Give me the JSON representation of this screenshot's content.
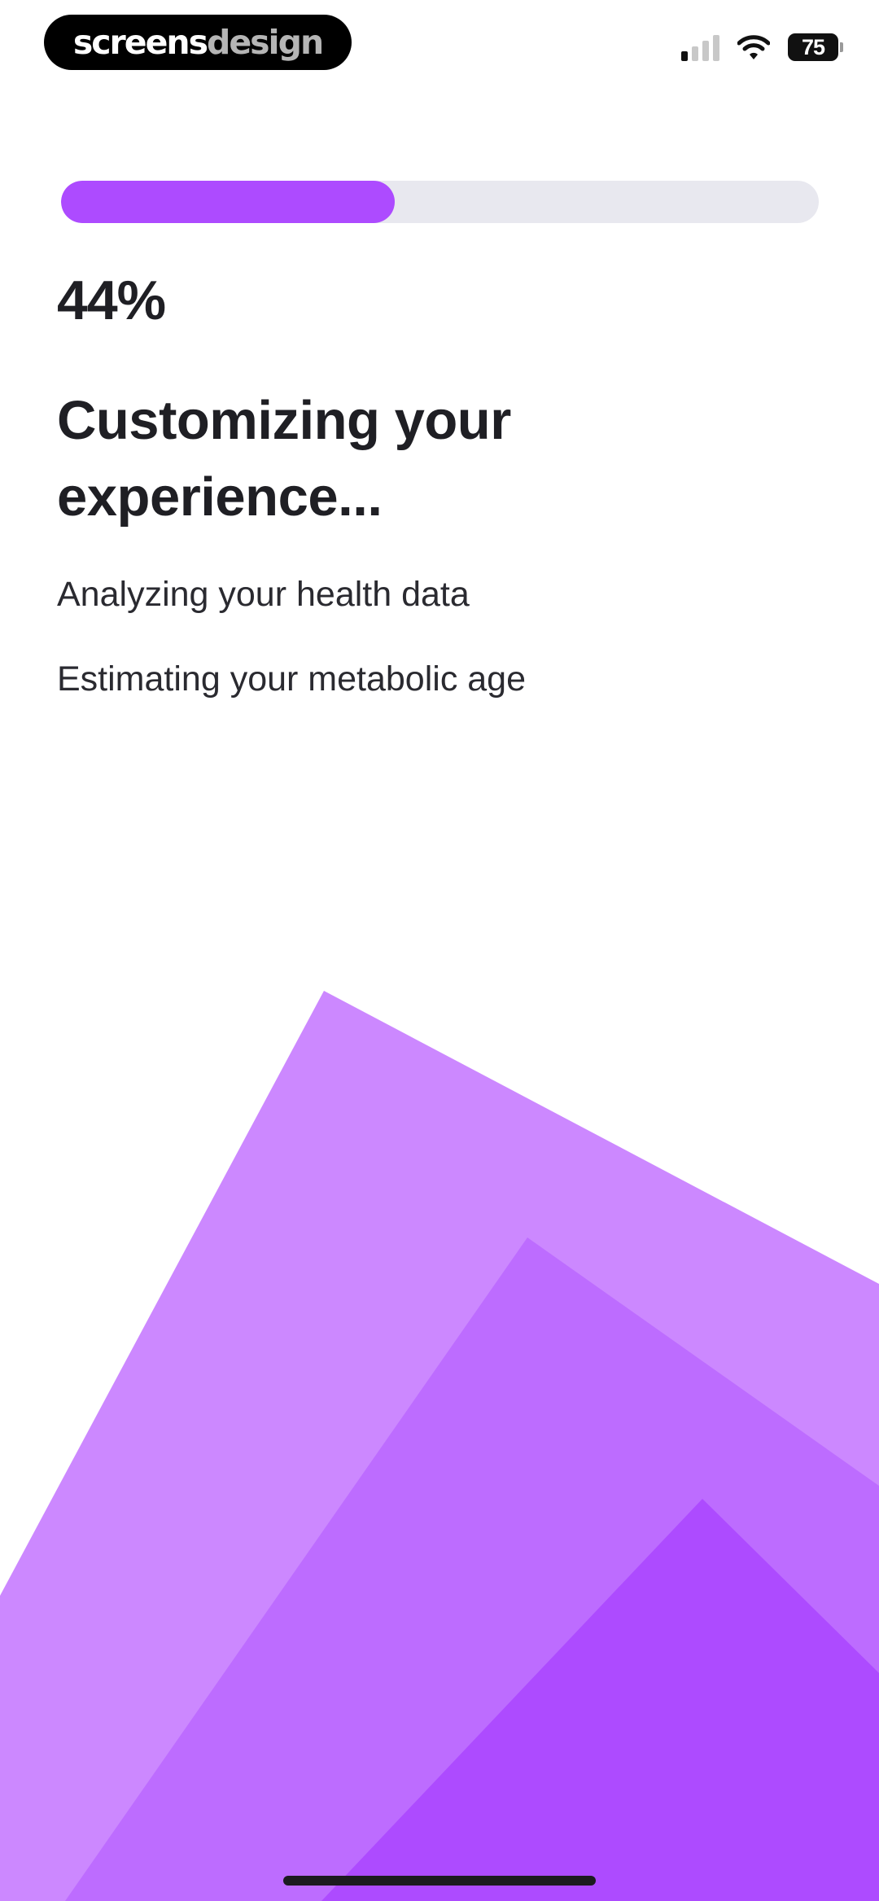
{
  "status_bar": {
    "brand_part1": "screens",
    "brand_part2": "design",
    "battery_level": "75",
    "signal_icon": "cellular-signal-icon",
    "wifi_icon": "wifi-icon",
    "battery_icon": "battery-icon"
  },
  "progress": {
    "value": 0.44,
    "percent_label": "44%"
  },
  "main": {
    "title": "Customizing your experience...",
    "steps": [
      "Analyzing your health data",
      "Estimating your metabolic age"
    ]
  },
  "colors": {
    "accent": "#ad4bff",
    "shape_light": "#cc88ff",
    "shape_mid": "#bd6cff",
    "shape_dark": "#ad4bff",
    "track": "#e8e8ef",
    "text": "#1f1f24"
  }
}
